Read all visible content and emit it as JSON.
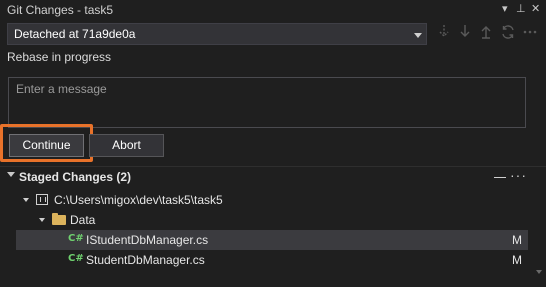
{
  "panel": {
    "title": "Git Changes - task5",
    "controls": [
      "▾",
      "⊥",
      "✕"
    ]
  },
  "branch": {
    "label": "Detached at 71a9de0a"
  },
  "toolbar": {
    "icons": [
      "fetch-icon",
      "pull-icon",
      "push-icon",
      "sync-icon",
      "more-icon"
    ]
  },
  "rebase": {
    "status": "Rebase in progress"
  },
  "commit": {
    "placeholder": "Enter a message",
    "continue_label": "Continue",
    "abort_label": "Abort"
  },
  "staged": {
    "header": "Staged Changes (2)",
    "repo_path": "C:\\Users\\migox\\dev\\task5\\task5",
    "folder": "Data",
    "files": [
      {
        "name": "IStudentDbManager.cs",
        "status": "M"
      },
      {
        "name": "StudentDbManager.cs",
        "status": "M"
      }
    ]
  },
  "colors": {
    "highlight": "#e8722a",
    "csharp_icon": "#6fd06f",
    "folder_icon": "#dcb35c"
  }
}
